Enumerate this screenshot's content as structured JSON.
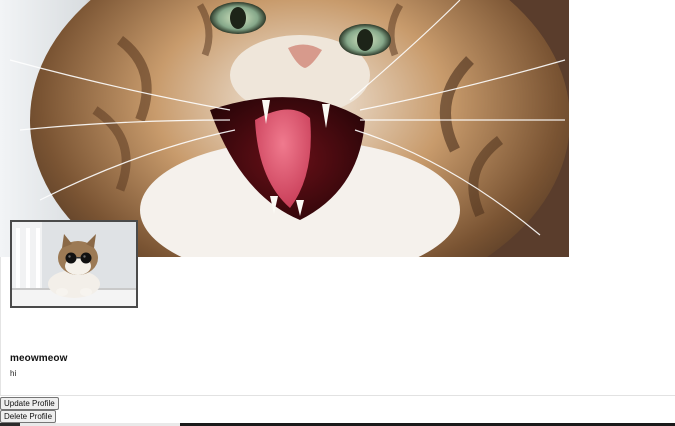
{
  "profile": {
    "cover_photo": "cat-hissing-photo",
    "avatar_photo": "cat-sunglasses-photo",
    "username": "meowmeow",
    "bio": "hi"
  },
  "actions": {
    "update_label": "Update Profile",
    "delete_label": "Delete Profile"
  },
  "colors": {
    "button_bg": "#efefef",
    "button_border": "#767676",
    "divider": "#e2e2e2"
  }
}
